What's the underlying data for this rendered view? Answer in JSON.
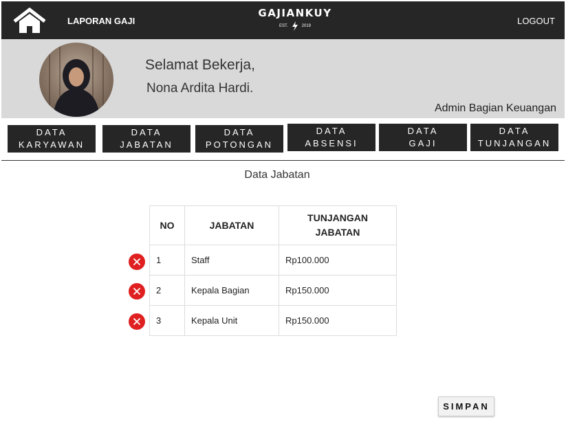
{
  "header": {
    "report_link": "LAPORAN GAJI",
    "brand_name": "GAJIANKUY",
    "brand_est": "EST.",
    "brand_year": "2019",
    "logout": "LOGOUT"
  },
  "welcome": {
    "greeting": "Selamat Bekerja,",
    "name": "Nona Ardita Hardi.",
    "role": "Admin Bagian Keuangan"
  },
  "nav": [
    {
      "line1": "DATA",
      "line2": "KARYAWAN"
    },
    {
      "line1": "DATA",
      "line2": "JABATAN"
    },
    {
      "line1": "DATA",
      "line2": "POTONGAN"
    },
    {
      "line1": "DATA",
      "line2": "ABSENSI"
    },
    {
      "line1": "DATA",
      "line2": "GAJI"
    },
    {
      "line1": "DATA",
      "line2": "TUNJANGAN"
    }
  ],
  "content": {
    "title": "Data Jabatan",
    "columns": [
      "NO",
      "JABATAN",
      "TUNJANGAN JABATAN"
    ],
    "rows": [
      {
        "no": "1",
        "jabatan": "Staff",
        "tunjangan": "Rp100.000"
      },
      {
        "no": "2",
        "jabatan": "Kepala Bagian",
        "tunjangan": "Rp150.000"
      },
      {
        "no": "3",
        "jabatan": "Kepala Unit",
        "tunjangan": "Rp150.000"
      }
    ],
    "save_label": "SIMPAN"
  },
  "icons": {
    "home": "home-icon",
    "delete": "close-icon",
    "bolt": "lightning-icon"
  },
  "colors": {
    "header_bg": "#262626",
    "welcome_bg": "#d9d9d9",
    "delete_red": "#e02020"
  }
}
